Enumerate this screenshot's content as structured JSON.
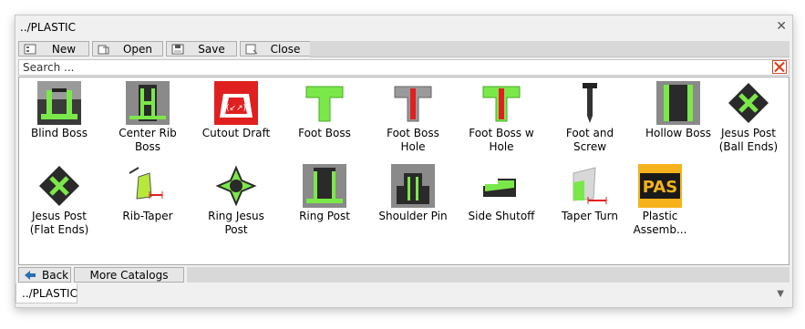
{
  "window": {
    "title": "../PLASTIC"
  },
  "toolbar": {
    "new_label": "New",
    "open_label": "Open",
    "save_label": "Save",
    "close_label": "Close"
  },
  "search": {
    "placeholder": "Search ...",
    "value": ""
  },
  "catalog": {
    "items": [
      {
        "label": "Blind Boss",
        "icon": "blind-boss-icon"
      },
      {
        "label": "Center Rib Boss",
        "icon": "center-rib-boss-icon"
      },
      {
        "label": "Cutout Draft",
        "icon": "cutout-draft-icon"
      },
      {
        "label": "Foot Boss",
        "icon": "foot-boss-icon"
      },
      {
        "label": "Foot Boss Hole",
        "icon": "foot-boss-hole-icon"
      },
      {
        "label": "Foot Boss w Hole",
        "icon": "foot-boss-w-hole-icon"
      },
      {
        "label": "Foot and Screw",
        "icon": "foot-and-screw-icon"
      },
      {
        "label": "Hollow Boss",
        "icon": "hollow-boss-icon"
      },
      {
        "label": "Jesus Post (Ball Ends)",
        "icon": "jesus-post-ball-icon"
      },
      {
        "label": "Jesus Post (Flat Ends)",
        "icon": "jesus-post-flat-icon"
      },
      {
        "label": "Rib-Taper",
        "icon": "rib-taper-icon"
      },
      {
        "label": "Ring Jesus Post",
        "icon": "ring-jesus-post-icon"
      },
      {
        "label": "Ring Post",
        "icon": "ring-post-icon"
      },
      {
        "label": "Shoulder Pin",
        "icon": "shoulder-pin-icon"
      },
      {
        "label": "Side Shutoff",
        "icon": "side-shutoff-icon"
      },
      {
        "label": "Taper Turn",
        "icon": "taper-turn-icon"
      },
      {
        "label": "Plastic Assemb...",
        "icon": "pas-logo-icon"
      }
    ]
  },
  "bottom": {
    "back_label": "Back",
    "more_label": "More Catalogs"
  },
  "path_tab": {
    "label": "../PLASTIC"
  },
  "colors": {
    "accent_green": "#7be84a",
    "red": "#e02020",
    "dark": "#2a2a2a",
    "pas_yellow": "#f5b21a"
  }
}
